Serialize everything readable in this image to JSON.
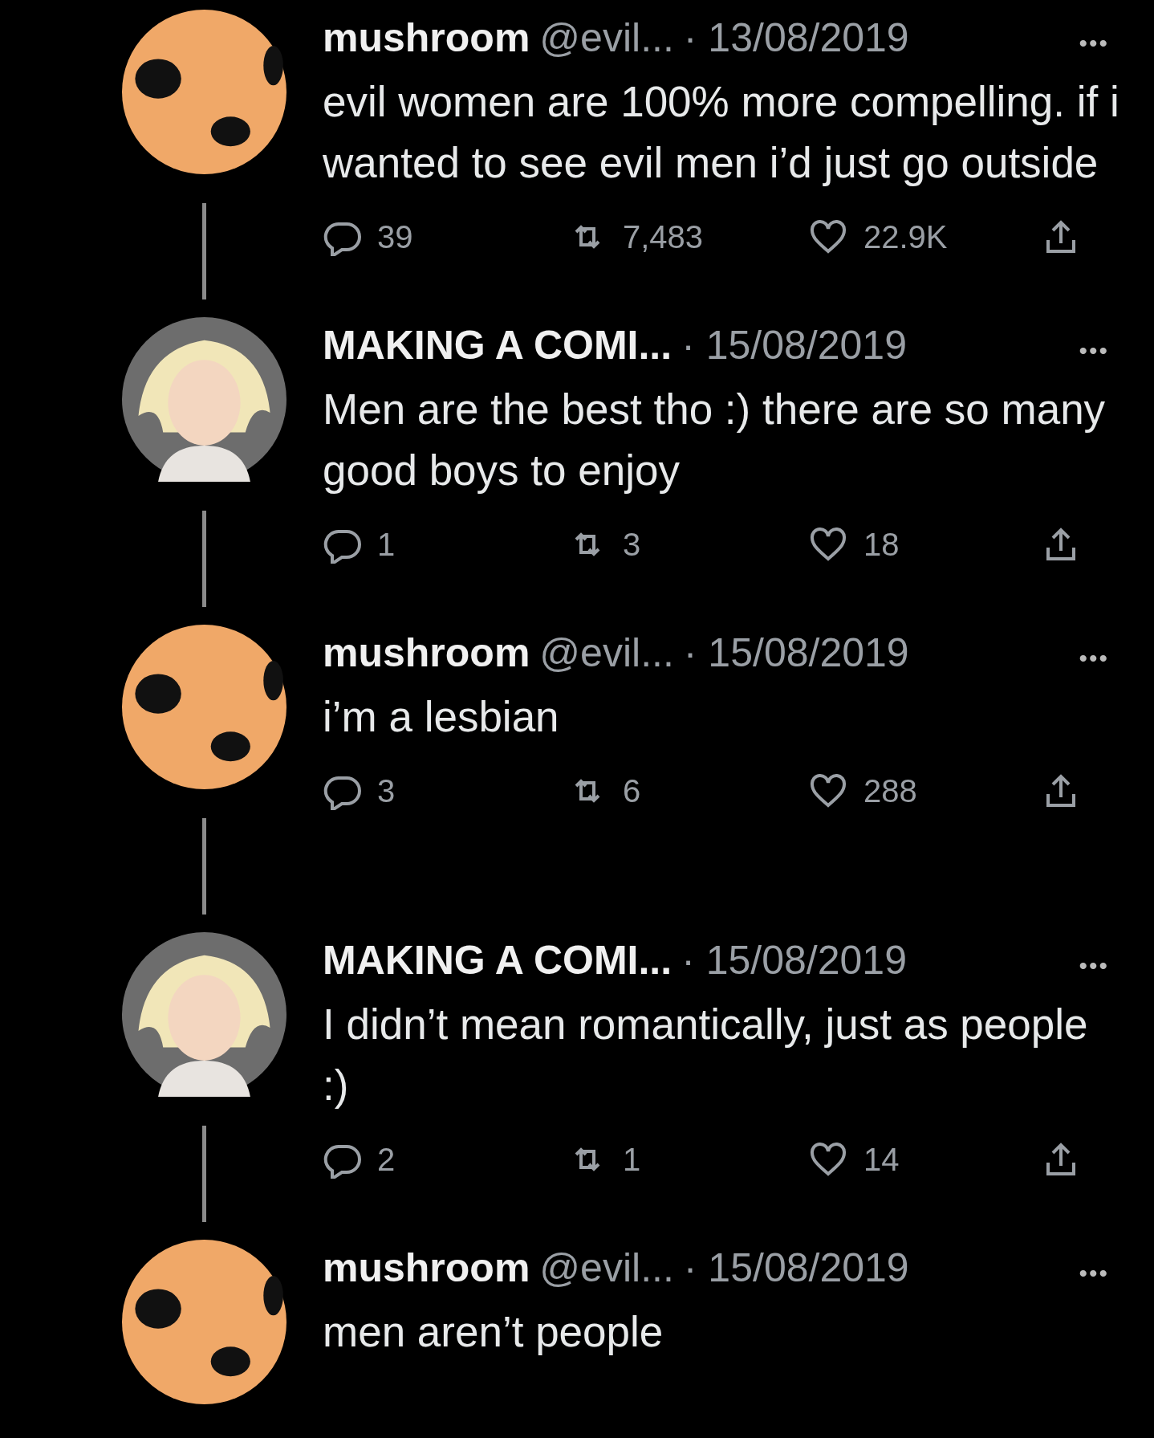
{
  "tweets": [
    {
      "kind": "mushroom",
      "name": "mushroom",
      "handle": "@evil...",
      "date": "· 13/08/2019",
      "menu": "•••",
      "text": "evil women are 100% more compelling. if i wanted to see evil men i’d just go outside",
      "replies": "39",
      "retweets": "7,483",
      "likes": "22.9K",
      "thread_continues": true
    },
    {
      "kind": "character",
      "name": "MAKING A COMI...",
      "date": "· 15/08/2019",
      "menu": "•••",
      "text": "Men are the best tho :) there are so many good boys to enjoy",
      "replies": "1",
      "retweets": "3",
      "likes": "18",
      "thread_continues": true
    },
    {
      "kind": "mushroom",
      "name": "mushroom",
      "handle": "@evil...",
      "date": "· 15/08/2019",
      "menu": "•••",
      "text": "i’m a lesbian",
      "replies": "3",
      "retweets": "6",
      "likes": "288",
      "thread_continues": true
    },
    {
      "kind": "character",
      "name": "MAKING A COMI...",
      "date": "· 15/08/2019",
      "menu": "•••",
      "text": "I didn’t mean romantically, just as people :)",
      "replies": "2",
      "retweets": "1",
      "likes": "14",
      "thread_continues": true
    },
    {
      "kind": "mushroom",
      "name": "mushroom",
      "handle": "@evil...",
      "date": "· 15/08/2019",
      "menu": "•••",
      "text": "men aren’t people",
      "thread_continues": false
    }
  ]
}
